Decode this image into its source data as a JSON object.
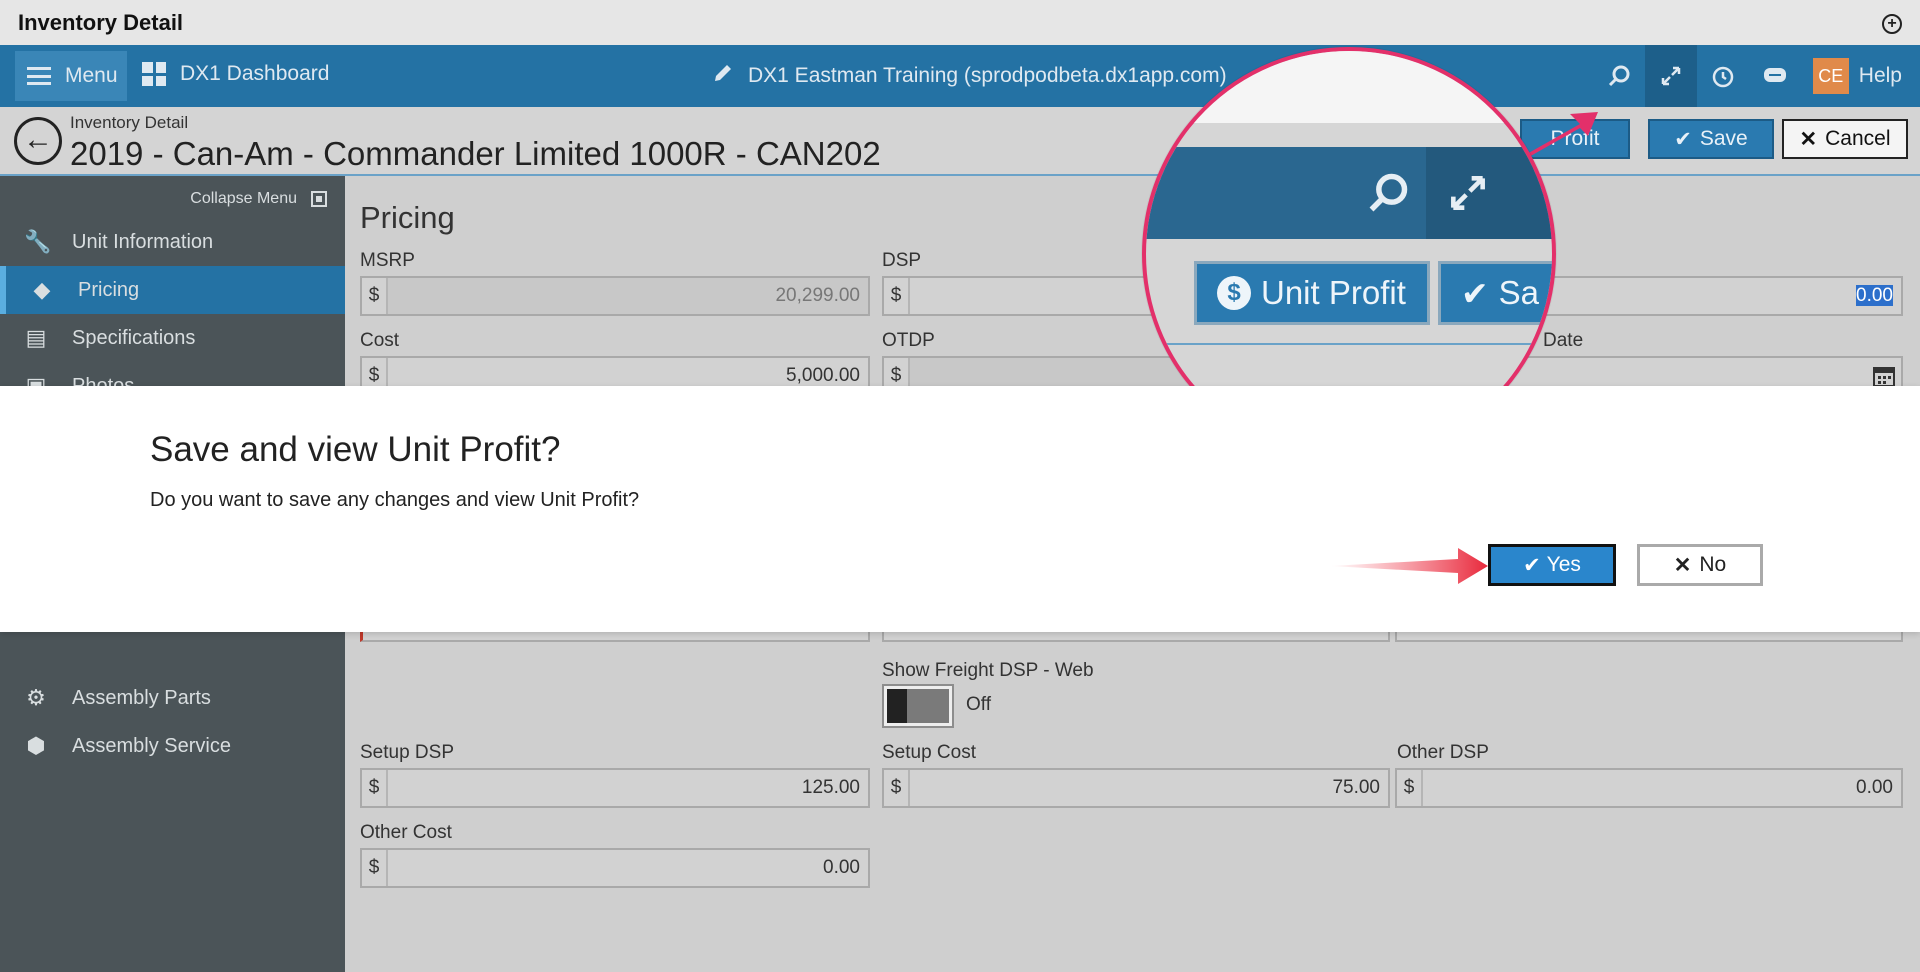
{
  "window": {
    "title": "Inventory Detail"
  },
  "topnav": {
    "menu_label": "Menu",
    "dashboard_label": "DX1 Dashboard",
    "center_label": "DX1 Eastman Training (sprodpodbeta.dx1app.com)",
    "avatar_initials": "CE",
    "help_label": "Help"
  },
  "header": {
    "breadcrumb": "Inventory Detail",
    "title": "2019 - Can-Am - Commander Limited 1000R - CAN202",
    "unit_profit_label": "Profit",
    "save_label": "Save",
    "cancel_label": "Cancel"
  },
  "sidebar": {
    "collapse_label": "Collapse Menu",
    "items": [
      {
        "label": "Unit Information",
        "icon": "wrench-icon"
      },
      {
        "label": "Pricing",
        "icon": "tag-icon"
      },
      {
        "label": "Specifications",
        "icon": "document-icon"
      },
      {
        "label": "Photos",
        "icon": "image-icon"
      },
      {
        "label": "Assembly Parts",
        "icon": "gear-icon"
      },
      {
        "label": "Assembly Service",
        "icon": "box-icon"
      }
    ]
  },
  "pricing": {
    "section_title": "Pricing",
    "currency": "$",
    "msrp": {
      "label": "MSRP",
      "value": "20,299.00"
    },
    "dsp": {
      "label": "DSP",
      "value": ""
    },
    "third_top": {
      "value": "0.00"
    },
    "cost": {
      "label": "Cost",
      "value": "5,000.00"
    },
    "otdp": {
      "label": "OTDP",
      "value": ""
    },
    "date": {
      "label": "Date"
    },
    "show_freight": {
      "label": "Show Freight DSP - Web",
      "state": "Off"
    },
    "setup_dsp": {
      "label": "Setup DSP",
      "value": "125.00"
    },
    "setup_cost": {
      "label": "Setup Cost",
      "value": "75.00"
    },
    "other_dsp": {
      "label": "Other DSP",
      "value": "0.00"
    },
    "other_cost": {
      "label": "Other Cost",
      "value": "0.00"
    }
  },
  "magnifier": {
    "unit_profit_label": "Unit Profit",
    "save_partial": "Sa"
  },
  "modal": {
    "title": "Save and view Unit Profit?",
    "message": "Do you want to save any changes and view Unit Profit?",
    "yes_label": "Yes",
    "no_label": "No"
  },
  "colors": {
    "nav": "#2472a4",
    "sidebar": "#4b5458",
    "highlight_ring": "#e3306a",
    "primary_button": "#2a86cc"
  }
}
